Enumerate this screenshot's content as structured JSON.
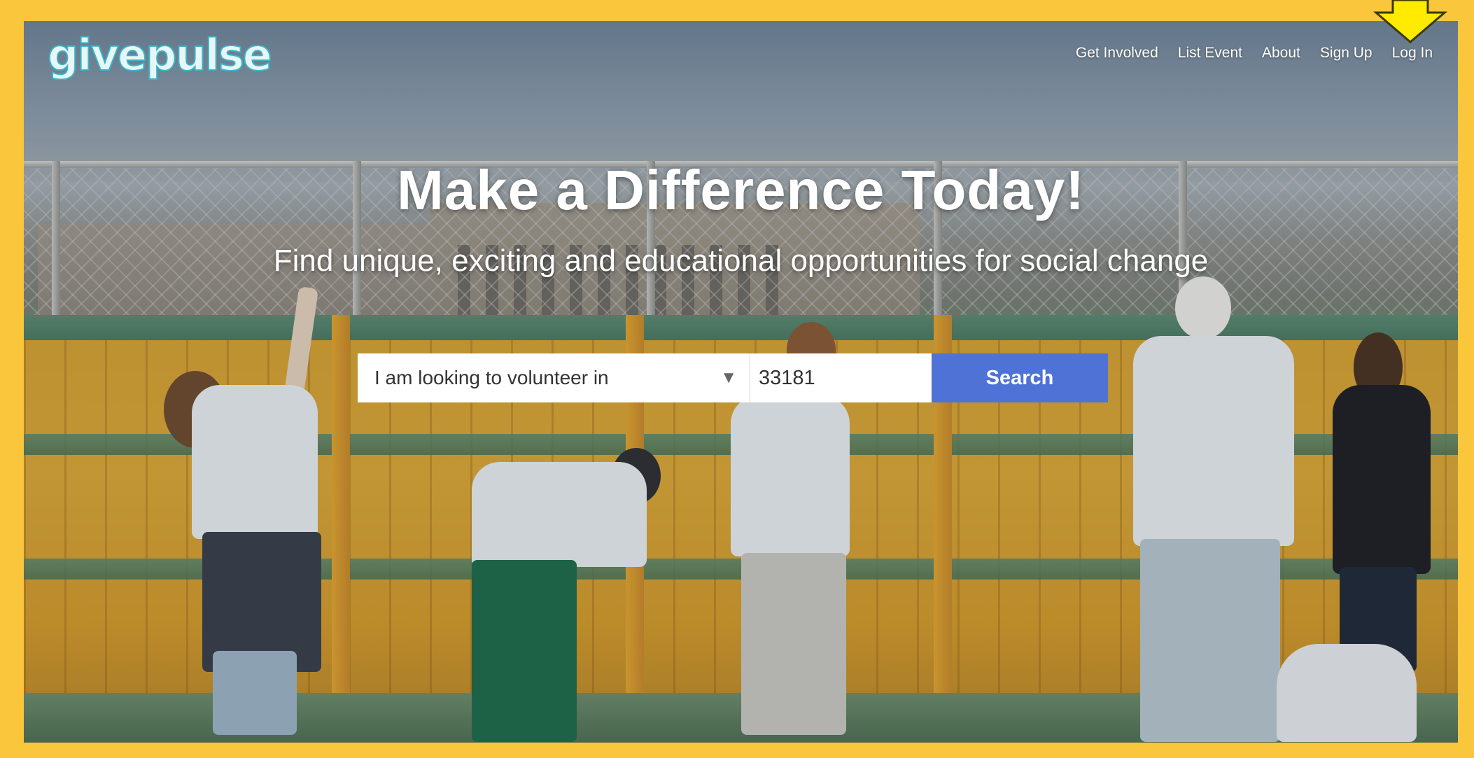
{
  "brand": {
    "logo_text": "givepulse",
    "accent_color": "#FAC73C",
    "logo_color": "#37B5C8"
  },
  "nav": {
    "items": [
      "Get Involved",
      "List Event",
      "About",
      "Sign Up",
      "Log In"
    ],
    "highlight_indicator": "arrow-down-icon"
  },
  "hero": {
    "title": "Make a Difference Today!",
    "subtitle": "Find unique, exciting and educational opportunities for social change"
  },
  "search": {
    "select_value": "I am looking to volunteer in",
    "zip_value": "33181",
    "button_label": "Search",
    "button_color": "#4F72D6"
  }
}
